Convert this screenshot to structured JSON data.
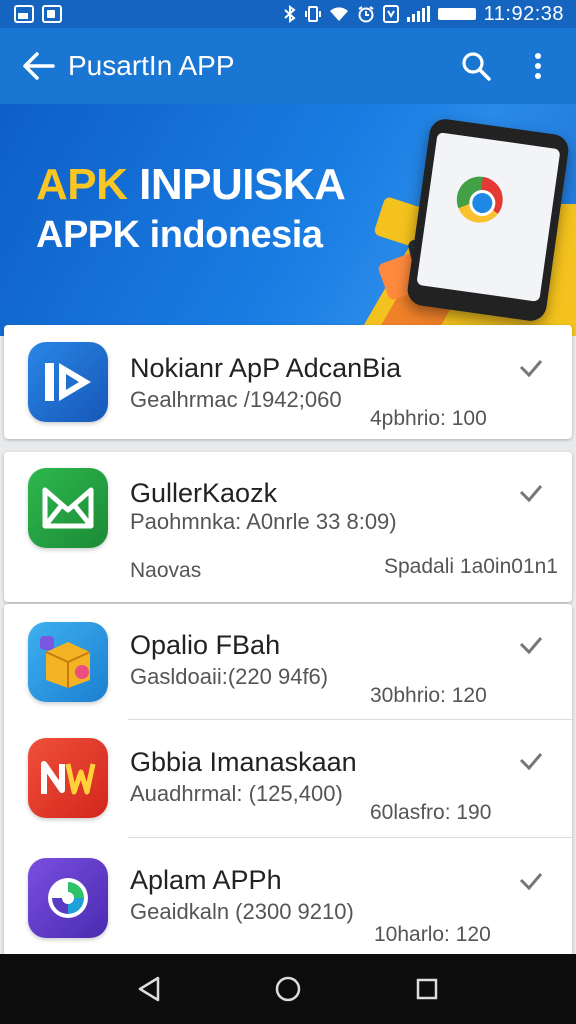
{
  "status_bar": {
    "time": "11:92:38",
    "icons": [
      "image-icon",
      "gallery-icon",
      "bluetooth-icon",
      "vibrate-icon",
      "wifi-icon",
      "alarm-icon",
      "data-icon",
      "signal-icon",
      "battery-icon"
    ]
  },
  "app_bar": {
    "title": "PusartIn APP",
    "icons": [
      "back-arrow-icon",
      "search-icon",
      "more-vert-icon"
    ]
  },
  "banner": {
    "line1_accent": "APK",
    "line1_rest": "INPUISKA",
    "line2": "APPK indonesia"
  },
  "apps": [
    {
      "name": "Nokianr ApP AdcanBia",
      "subtitle": "Gealhrmac /1942;060",
      "meta_left": "",
      "meta_right": "4pbhrio: 100",
      "icon": "play-icon",
      "icon_color": "#1e6fd0"
    },
    {
      "name": "GullerKaozk",
      "subtitle": "Paohmnka: A0nrle 33 8:09)",
      "meta_left": "Naovas",
      "meta_right": "Spadali 1a0in01n1",
      "icon": "kite-icon",
      "icon_color": "#25a244"
    },
    {
      "name": "Opalio FBah",
      "subtitle": "Gasldoaii:(220 94f6)",
      "meta_left": "",
      "meta_right": "30bhrio: 120",
      "icon": "box-icon",
      "icon_color": "#2a9be6"
    },
    {
      "name": "Gbbia Imanaskaan",
      "subtitle": "Auadhrmal: (125,400)",
      "meta_left": "",
      "meta_right": "60lasfro: 190",
      "icon": "nw-logo-icon",
      "icon_color": "#e8392b"
    },
    {
      "name": "Aplam APPh",
      "subtitle": "Geaidkaln (2300 9210)",
      "meta_left": "",
      "meta_right": "10harlo: 120",
      "icon": "swirl-icon",
      "icon_color": "#5a3bc4"
    }
  ],
  "nav_bar": {
    "icons": [
      "nav-back-icon",
      "nav-home-icon",
      "nav-recents-icon"
    ]
  }
}
